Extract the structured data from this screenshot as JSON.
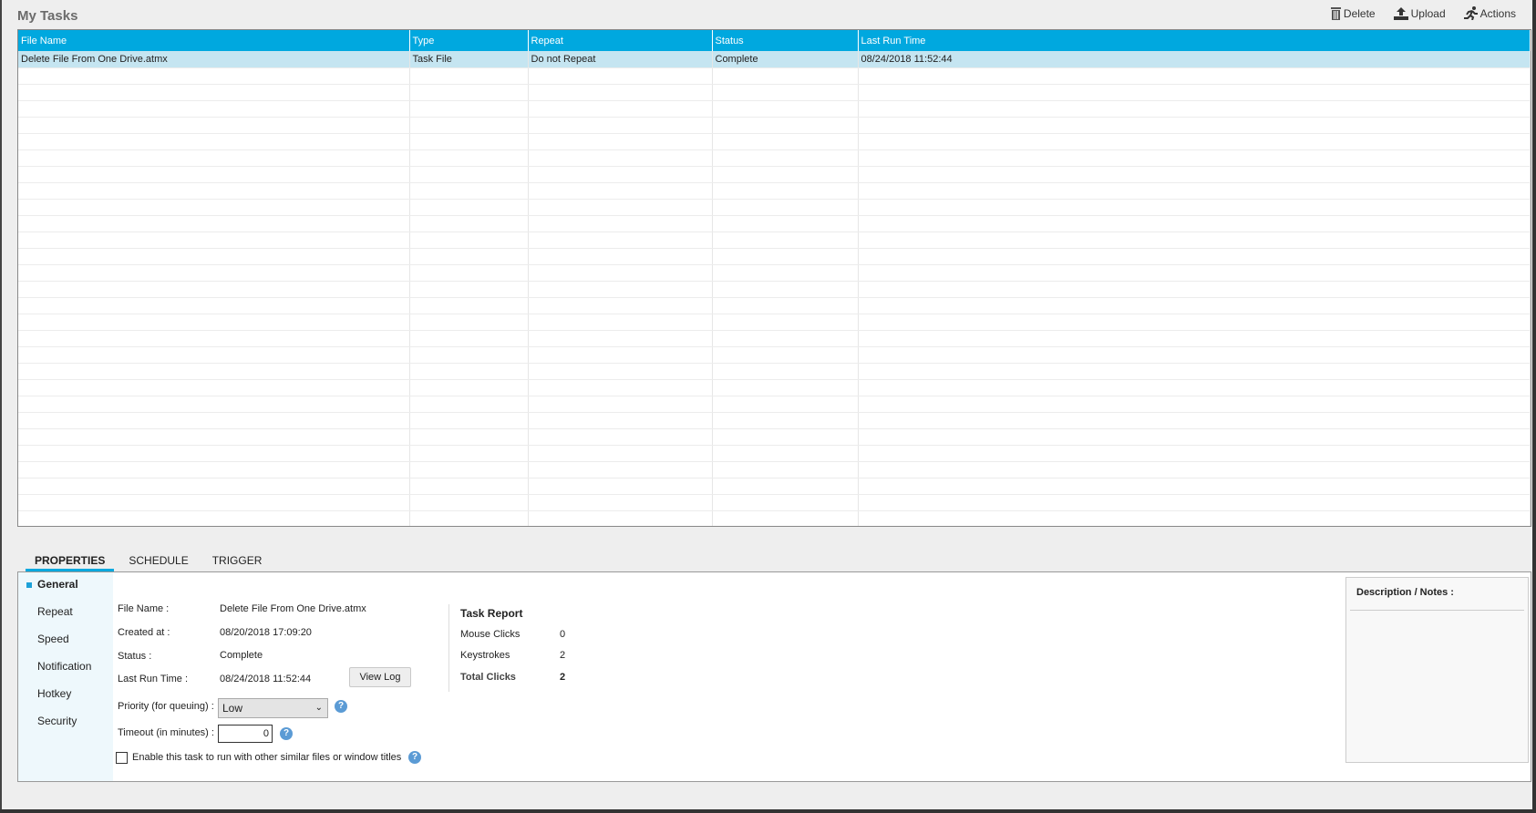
{
  "title": "My Tasks",
  "toolbar": {
    "delete": "Delete",
    "upload": "Upload",
    "actions": "Actions"
  },
  "grid": {
    "columns": [
      "File Name",
      "Type",
      "Repeat",
      "Status",
      "Last Run Time"
    ],
    "rows": [
      [
        "Delete File From One Drive.atmx",
        "Task File",
        "Do not Repeat",
        "Complete",
        "08/24/2018 11:52:44"
      ]
    ]
  },
  "tabs": [
    "PROPERTIES",
    "SCHEDULE",
    "TRIGGER"
  ],
  "side": [
    "General",
    "Repeat",
    "Speed",
    "Notification",
    "Hotkey",
    "Security"
  ],
  "general": {
    "file_name_label": "File Name :",
    "file_name": "Delete File From One Drive.atmx",
    "created_label": "Created at :",
    "created": "08/20/2018 17:09:20",
    "status_label": "Status :",
    "status": "Complete",
    "last_run_label": "Last Run Time :",
    "last_run": "08/24/2018 11:52:44",
    "view_log": "View Log",
    "priority_label": "Priority (for queuing) :",
    "priority": "Low",
    "timeout_label": "Timeout (in minutes) :",
    "timeout": "0",
    "enable_label": "Enable this task to run with other similar files or window titles",
    "help": "?"
  },
  "report": {
    "title": "Task Report",
    "mouse_label": "Mouse Clicks",
    "mouse": "0",
    "keys_label": "Keystrokes",
    "keys": "2",
    "total_label": "Total Clicks",
    "total": "2"
  },
  "description": {
    "title": "Description / Notes :"
  }
}
